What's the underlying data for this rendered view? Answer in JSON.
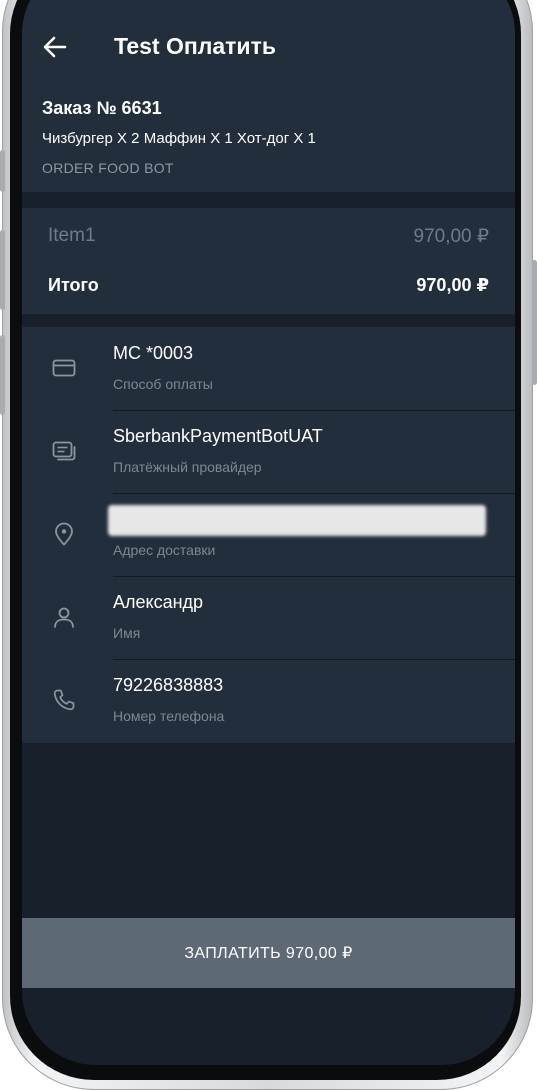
{
  "app_bar": {
    "title": "Test Оплатить"
  },
  "order": {
    "title": "Заказ № 6631",
    "items": "Чизбургер X 2 Маффин X 1 Хот-дог X 1",
    "bot_name": "ORDER FOOD BOT"
  },
  "prices": {
    "item_label": "Item1",
    "item_value": "970,00 ₽",
    "total_label": "Итого",
    "total_value": "970,00 ₽"
  },
  "info": {
    "payment_method": {
      "value": "MC *0003",
      "caption": "Способ оплаты",
      "icon": "credit-card-icon"
    },
    "provider": {
      "value": "SberbankPaymentBotUAT",
      "caption": "Платёжный провайдер",
      "icon": "receipt-icon"
    },
    "address": {
      "value": "",
      "caption": "Адрес доставки",
      "icon": "location-pin-icon"
    },
    "name": {
      "value": "Александр",
      "caption": "Имя",
      "icon": "user-icon"
    },
    "phone": {
      "value": "79226838883",
      "caption": "Номер телефона",
      "icon": "phone-icon"
    }
  },
  "pay_button": {
    "label": "ЗАПЛАТИТЬ 970,00 ₽"
  },
  "colors": {
    "screen_bg": "#18202b",
    "panel_bg": "#232e3c",
    "button_bg": "#5e6976",
    "muted_text": "#7d8894"
  }
}
